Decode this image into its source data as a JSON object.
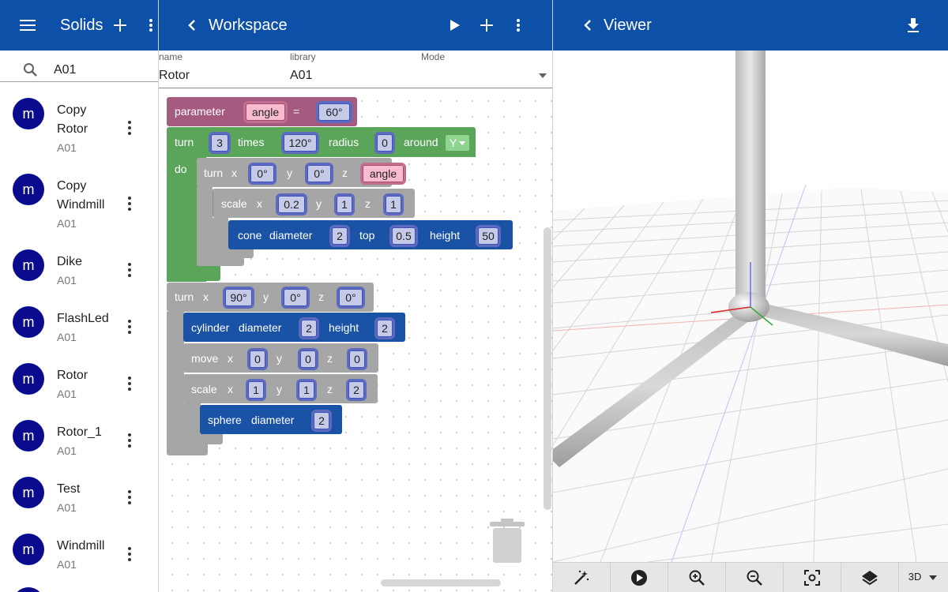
{
  "left_bar": {
    "title": "Solids"
  },
  "workspace_bar": {
    "title": "Workspace"
  },
  "viewer_bar": {
    "title": "Viewer"
  },
  "search": {
    "value": "A01"
  },
  "solids": [
    {
      "initial": "m",
      "name_line1": "Copy",
      "name_line2": "Rotor",
      "library": "A01"
    },
    {
      "initial": "m",
      "name_line1": "Copy",
      "name_line2": "Windmill",
      "library": "A01"
    },
    {
      "initial": "m",
      "name_line1": "Dike",
      "name_line2": "",
      "library": "A01"
    },
    {
      "initial": "m",
      "name_line1": "FlashLed",
      "name_line2": "",
      "library": "A01"
    },
    {
      "initial": "m",
      "name_line1": "Rotor",
      "name_line2": "",
      "library": "A01"
    },
    {
      "initial": "m",
      "name_line1": "Rotor_1",
      "name_line2": "",
      "library": "A01"
    },
    {
      "initial": "m",
      "name_line1": "Test",
      "name_line2": "",
      "library": "A01"
    },
    {
      "initial": "m",
      "name_line1": "Windmill",
      "name_line2": "",
      "library": "A01"
    }
  ],
  "meta": {
    "name_label": "name",
    "name_value": "Rotor",
    "library_label": "library",
    "library_value": "A01",
    "mode_label": "Mode"
  },
  "blocks": {
    "parameter": {
      "kw": "parameter",
      "var": "angle",
      "eq": "=",
      "value": "60°"
    },
    "turn1": {
      "kw": "turn",
      "count": "3",
      "times": "times",
      "angle": "120°",
      "radius_kw": "radius",
      "radius": "0",
      "around_kw": "around",
      "axis": "Y",
      "do": "do"
    },
    "turn2": {
      "kw": "turn",
      "x_kw": "x",
      "x": "0°",
      "y_kw": "y",
      "y": "0°",
      "z_kw": "z",
      "z": "angle"
    },
    "scale1": {
      "kw": "scale",
      "x_kw": "x",
      "x": "0.2",
      "y_kw": "y",
      "y": "1",
      "z_kw": "z",
      "z": "1"
    },
    "cone": {
      "kw": "cone",
      "diam_kw": "diameter",
      "diameter": "2",
      "top_kw": "top",
      "top": "0.5",
      "height_kw": "height",
      "height": "50"
    },
    "turn3": {
      "kw": "turn",
      "x_kw": "x",
      "x": "90°",
      "y_kw": "y",
      "y": "0°",
      "z_kw": "z",
      "z": "0°"
    },
    "cylinder": {
      "kw": "cylinder",
      "diam_kw": "diameter",
      "diameter": "2",
      "height_kw": "height",
      "height": "2"
    },
    "move": {
      "kw": "move",
      "x_kw": "x",
      "x": "0",
      "y_kw": "y",
      "y": "0",
      "z_kw": "z",
      "z": "0"
    },
    "scale2": {
      "kw": "scale",
      "x_kw": "x",
      "x": "1",
      "y_kw": "y",
      "y": "1",
      "z_kw": "z",
      "z": "2"
    },
    "sphere": {
      "kw": "sphere",
      "diam_kw": "diameter",
      "diameter": "2"
    }
  },
  "viewer_toolbar": {
    "mode": "3D"
  },
  "colors": {
    "appbar": "#0d50a7",
    "avatar": "#0a0a8c",
    "param_block": "#a55b80",
    "loop_block": "#5ba55b",
    "transform_block": "#a6a6a6",
    "shape_block": "#1a52a6"
  },
  "icons": [
    "menu-icon",
    "add-icon",
    "more-vert-icon",
    "back-icon",
    "play-icon",
    "download-icon",
    "search-icon",
    "trash-icon",
    "magic-wand-icon",
    "zoom-in-icon",
    "zoom-out-icon",
    "fit-view-icon",
    "layers-icon"
  ]
}
